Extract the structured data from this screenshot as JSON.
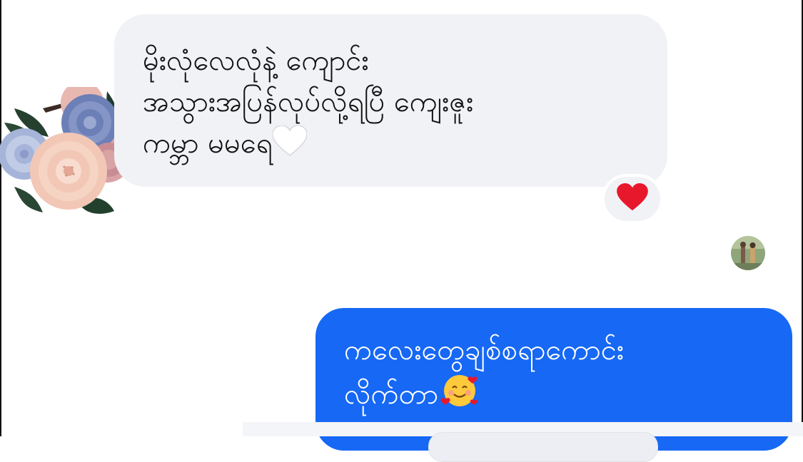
{
  "conversation": {
    "messages": [
      {
        "direction": "incoming",
        "lines": [
          "မိုးလုံလေလုံနဲ့ ကျောင်း",
          "အသွားအပြန်လုပ်လို့ရပြီ ကျေးဇူး",
          "ကမ္ဘာ မမရေ"
        ],
        "trailing_emoji": "white-heart-icon",
        "reaction": "red-heart-icon"
      },
      {
        "direction": "outgoing",
        "lines": [
          "ကလေးတွေချစ်စရာကောင်း",
          "လိုက်တာ"
        ],
        "trailing_emoji": "smiling-face-with-hearts-icon"
      }
    ]
  },
  "colors": {
    "incoming_bubble": "#f1f2f6",
    "outgoing_bubble": "#1668f5",
    "reaction_heart": "#e8182c"
  },
  "icons": {
    "sticker": "flower-sticker-icon",
    "avatar": "contact-avatar"
  }
}
